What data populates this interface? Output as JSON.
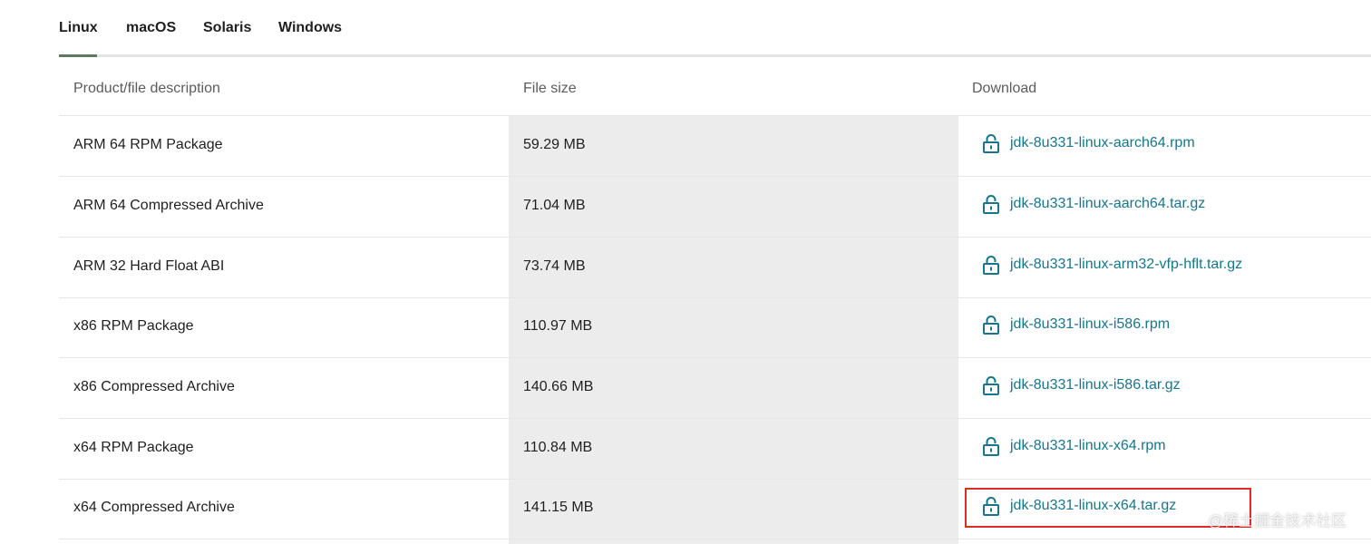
{
  "tabs": [
    {
      "label": "Linux",
      "active": true
    },
    {
      "label": "macOS",
      "active": false
    },
    {
      "label": "Solaris",
      "active": false
    },
    {
      "label": "Windows",
      "active": false
    }
  ],
  "table": {
    "headers": {
      "description": "Product/file description",
      "size": "File size",
      "download": "Download"
    },
    "rows": [
      {
        "description": "ARM 64 RPM Package",
        "size": "59.29 MB",
        "file": "jdk-8u331-linux-aarch64.rpm"
      },
      {
        "description": "ARM 64 Compressed Archive",
        "size": "71.04 MB",
        "file": "jdk-8u331-linux-aarch64.tar.gz"
      },
      {
        "description": "ARM 32 Hard Float ABI",
        "size": "73.74 MB",
        "file": "jdk-8u331-linux-arm32-vfp-hflt.tar.gz"
      },
      {
        "description": "x86 RPM Package",
        "size": "110.97 MB",
        "file": "jdk-8u331-linux-i586.rpm"
      },
      {
        "description": "x86 Compressed Archive",
        "size": "140.66 MB",
        "file": "jdk-8u331-linux-i586.tar.gz"
      },
      {
        "description": "x64 RPM Package",
        "size": "110.84 MB",
        "file": "jdk-8u331-linux-x64.rpm"
      },
      {
        "description": "x64 Compressed Archive",
        "size": "141.15 MB",
        "file": "jdk-8u331-linux-x64.tar.gz"
      }
    ]
  },
  "watermark": "@稀土掘金技术社区",
  "colors": {
    "accent_link": "#18758a",
    "tab_underline": "#5b7a5e",
    "highlight": "#e02b2b"
  },
  "icons": {
    "download_icon": "lock-icon"
  }
}
